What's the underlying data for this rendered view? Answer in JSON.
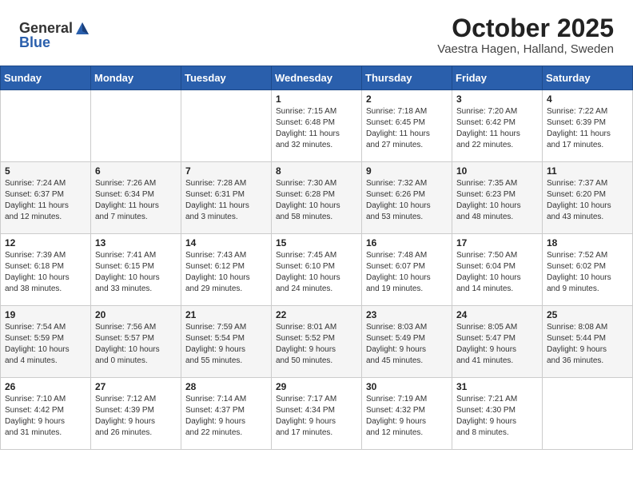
{
  "header": {
    "logo_general": "General",
    "logo_blue": "Blue",
    "month": "October 2025",
    "location": "Vaestra Hagen, Halland, Sweden"
  },
  "weekdays": [
    "Sunday",
    "Monday",
    "Tuesday",
    "Wednesday",
    "Thursday",
    "Friday",
    "Saturday"
  ],
  "weeks": [
    [
      {
        "day": "",
        "info": ""
      },
      {
        "day": "",
        "info": ""
      },
      {
        "day": "",
        "info": ""
      },
      {
        "day": "1",
        "info": "Sunrise: 7:15 AM\nSunset: 6:48 PM\nDaylight: 11 hours\nand 32 minutes."
      },
      {
        "day": "2",
        "info": "Sunrise: 7:18 AM\nSunset: 6:45 PM\nDaylight: 11 hours\nand 27 minutes."
      },
      {
        "day": "3",
        "info": "Sunrise: 7:20 AM\nSunset: 6:42 PM\nDaylight: 11 hours\nand 22 minutes."
      },
      {
        "day": "4",
        "info": "Sunrise: 7:22 AM\nSunset: 6:39 PM\nDaylight: 11 hours\nand 17 minutes."
      }
    ],
    [
      {
        "day": "5",
        "info": "Sunrise: 7:24 AM\nSunset: 6:37 PM\nDaylight: 11 hours\nand 12 minutes."
      },
      {
        "day": "6",
        "info": "Sunrise: 7:26 AM\nSunset: 6:34 PM\nDaylight: 11 hours\nand 7 minutes."
      },
      {
        "day": "7",
        "info": "Sunrise: 7:28 AM\nSunset: 6:31 PM\nDaylight: 11 hours\nand 3 minutes."
      },
      {
        "day": "8",
        "info": "Sunrise: 7:30 AM\nSunset: 6:28 PM\nDaylight: 10 hours\nand 58 minutes."
      },
      {
        "day": "9",
        "info": "Sunrise: 7:32 AM\nSunset: 6:26 PM\nDaylight: 10 hours\nand 53 minutes."
      },
      {
        "day": "10",
        "info": "Sunrise: 7:35 AM\nSunset: 6:23 PM\nDaylight: 10 hours\nand 48 minutes."
      },
      {
        "day": "11",
        "info": "Sunrise: 7:37 AM\nSunset: 6:20 PM\nDaylight: 10 hours\nand 43 minutes."
      }
    ],
    [
      {
        "day": "12",
        "info": "Sunrise: 7:39 AM\nSunset: 6:18 PM\nDaylight: 10 hours\nand 38 minutes."
      },
      {
        "day": "13",
        "info": "Sunrise: 7:41 AM\nSunset: 6:15 PM\nDaylight: 10 hours\nand 33 minutes."
      },
      {
        "day": "14",
        "info": "Sunrise: 7:43 AM\nSunset: 6:12 PM\nDaylight: 10 hours\nand 29 minutes."
      },
      {
        "day": "15",
        "info": "Sunrise: 7:45 AM\nSunset: 6:10 PM\nDaylight: 10 hours\nand 24 minutes."
      },
      {
        "day": "16",
        "info": "Sunrise: 7:48 AM\nSunset: 6:07 PM\nDaylight: 10 hours\nand 19 minutes."
      },
      {
        "day": "17",
        "info": "Sunrise: 7:50 AM\nSunset: 6:04 PM\nDaylight: 10 hours\nand 14 minutes."
      },
      {
        "day": "18",
        "info": "Sunrise: 7:52 AM\nSunset: 6:02 PM\nDaylight: 10 hours\nand 9 minutes."
      }
    ],
    [
      {
        "day": "19",
        "info": "Sunrise: 7:54 AM\nSunset: 5:59 PM\nDaylight: 10 hours\nand 4 minutes."
      },
      {
        "day": "20",
        "info": "Sunrise: 7:56 AM\nSunset: 5:57 PM\nDaylight: 10 hours\nand 0 minutes."
      },
      {
        "day": "21",
        "info": "Sunrise: 7:59 AM\nSunset: 5:54 PM\nDaylight: 9 hours\nand 55 minutes."
      },
      {
        "day": "22",
        "info": "Sunrise: 8:01 AM\nSunset: 5:52 PM\nDaylight: 9 hours\nand 50 minutes."
      },
      {
        "day": "23",
        "info": "Sunrise: 8:03 AM\nSunset: 5:49 PM\nDaylight: 9 hours\nand 45 minutes."
      },
      {
        "day": "24",
        "info": "Sunrise: 8:05 AM\nSunset: 5:47 PM\nDaylight: 9 hours\nand 41 minutes."
      },
      {
        "day": "25",
        "info": "Sunrise: 8:08 AM\nSunset: 5:44 PM\nDaylight: 9 hours\nand 36 minutes."
      }
    ],
    [
      {
        "day": "26",
        "info": "Sunrise: 7:10 AM\nSunset: 4:42 PM\nDaylight: 9 hours\nand 31 minutes."
      },
      {
        "day": "27",
        "info": "Sunrise: 7:12 AM\nSunset: 4:39 PM\nDaylight: 9 hours\nand 26 minutes."
      },
      {
        "day": "28",
        "info": "Sunrise: 7:14 AM\nSunset: 4:37 PM\nDaylight: 9 hours\nand 22 minutes."
      },
      {
        "day": "29",
        "info": "Sunrise: 7:17 AM\nSunset: 4:34 PM\nDaylight: 9 hours\nand 17 minutes."
      },
      {
        "day": "30",
        "info": "Sunrise: 7:19 AM\nSunset: 4:32 PM\nDaylight: 9 hours\nand 12 minutes."
      },
      {
        "day": "31",
        "info": "Sunrise: 7:21 AM\nSunset: 4:30 PM\nDaylight: 9 hours\nand 8 minutes."
      },
      {
        "day": "",
        "info": ""
      }
    ]
  ]
}
